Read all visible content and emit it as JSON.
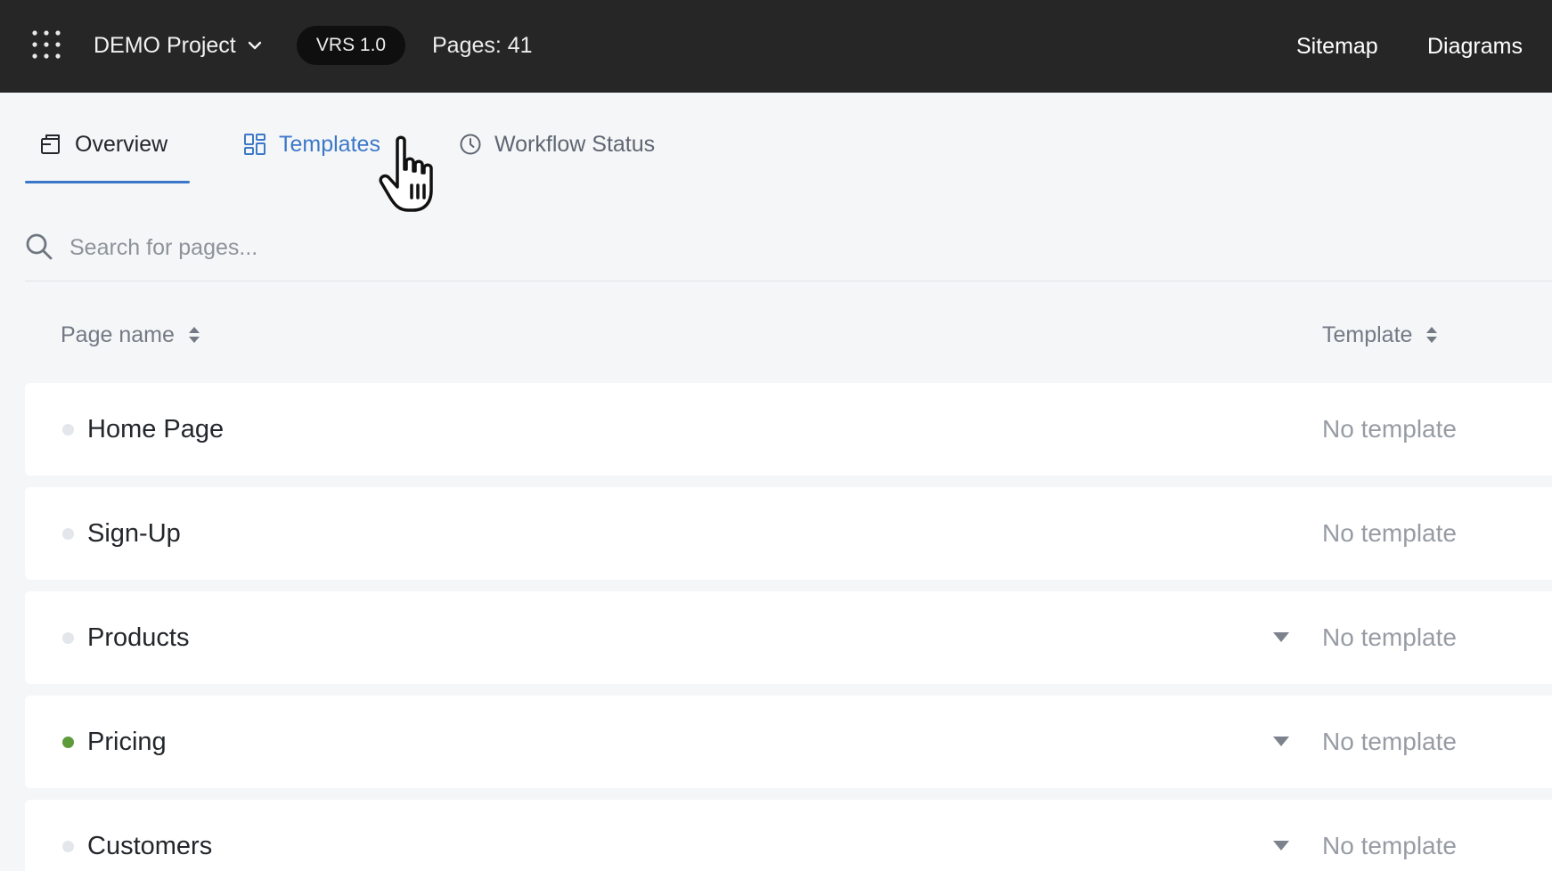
{
  "header": {
    "project_name": "DEMO Project",
    "version": "VRS 1.0",
    "page_count": "Pages: 41",
    "nav": {
      "sitemap": "Sitemap",
      "diagrams": "Diagrams"
    }
  },
  "tabs": [
    {
      "label": "Overview",
      "active": true,
      "icon": "overview-icon"
    },
    {
      "label": "Templates",
      "active": false,
      "hovered": true,
      "icon": "templates-grid-icon"
    },
    {
      "label": "Workflow Status",
      "active": false,
      "icon": "clock-icon"
    }
  ],
  "search": {
    "placeholder": "Search for pages...",
    "value": ""
  },
  "columns": {
    "page_name": "Page name",
    "template": "Template"
  },
  "rows": [
    {
      "name": "Home Page",
      "template": "No template",
      "status": "inactive",
      "has_dropdown": false
    },
    {
      "name": "Sign-Up",
      "template": "No template",
      "status": "inactive",
      "has_dropdown": false
    },
    {
      "name": "Products",
      "template": "No template",
      "status": "inactive",
      "has_dropdown": true
    },
    {
      "name": "Pricing",
      "template": "No template",
      "status": "active",
      "has_dropdown": true
    },
    {
      "name": "Customers",
      "template": "No template",
      "status": "inactive",
      "has_dropdown": true
    }
  ],
  "colors": {
    "topbar": "#262626",
    "accent": "#3b77c9",
    "status_active": "#5d9a3c",
    "status_inactive": "#e3e6ea"
  }
}
